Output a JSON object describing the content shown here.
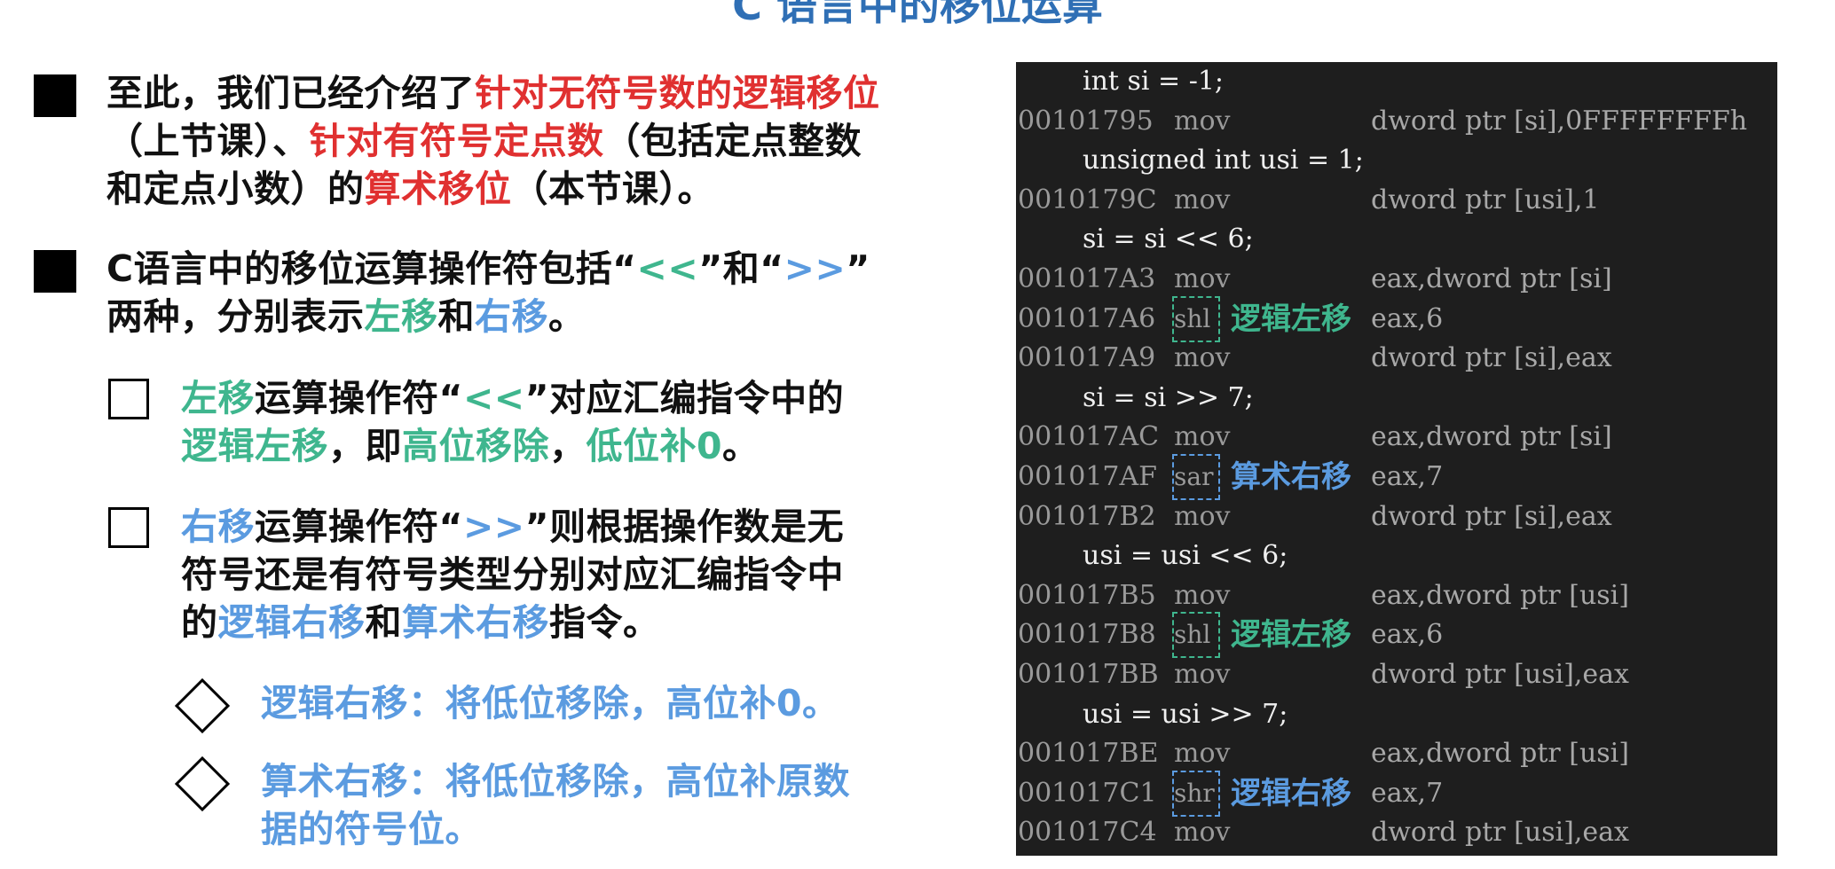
{
  "title": "C 语言中的移位运算",
  "colors": {
    "red": "#e03030",
    "green": "#3fb68e",
    "blue": "#5b9be0",
    "code_bg": "#1e1e1e"
  },
  "left": {
    "p1": {
      "a": "至此，我们已经介绍了",
      "b": "针对无符号数的逻辑移位",
      "c": "（上节课）、",
      "d": "针对有符号定点数",
      "e": "（包括定点整数",
      "f": "和定点小数）的",
      "g": "算术移位",
      "h": "（本节课）。"
    },
    "p2": {
      "a": "C语言中的移位运算操作符包括“",
      "b": "<<",
      "c": "”和“",
      "d": ">>",
      "e": "”",
      "f": "两种，分别表示",
      "g": "左移",
      "h": "和",
      "i": "右移",
      "j": "。"
    },
    "p3": {
      "a": "左移",
      "b": "运算操作符“",
      "c": "<<",
      "d": "”对应汇编指令中的",
      "e": "逻辑左移",
      "f": "，即",
      "g": "高位移除",
      "h": "，",
      "i": "低位补0",
      "j": "。"
    },
    "p4": {
      "a": "右移",
      "b": "运算操作符“",
      "c": ">>",
      "d": "”则根据操作数是无",
      "e": "符号还是有符号类型分别对应汇编指令中",
      "f": "的",
      "g": "逻辑右移",
      "h": "和",
      "i": "算术右移",
      "j": "指令。"
    },
    "p5": "逻辑右移：将低位移除，高位补0。",
    "p6": {
      "a": "算术右移：将低位移除，高位补原数",
      "b": "据的符号位。"
    }
  },
  "code": {
    "rows": [
      {
        "kind": "src",
        "text": "int si = -1;"
      },
      {
        "kind": "asm",
        "addr": "00101795",
        "op": "mov",
        "arg": "dword ptr [si],0FFFFFFFFh"
      },
      {
        "kind": "src",
        "text": "unsigned int usi = 1;"
      },
      {
        "kind": "asm",
        "addr": "0010179C",
        "op": "mov",
        "arg": "dword ptr [usi],1"
      },
      {
        "kind": "src",
        "text": "si = si << 6;"
      },
      {
        "kind": "asm",
        "addr": "001017A3",
        "op": "mov",
        "arg": "eax,dword ptr [si]"
      },
      {
        "kind": "asmhl",
        "addr": "001017A6",
        "op": "shl",
        "tag": "逻辑左移",
        "tone": "g",
        "arg": "eax,6"
      },
      {
        "kind": "asm",
        "addr": "001017A9",
        "op": "mov",
        "arg": "dword ptr [si],eax"
      },
      {
        "kind": "src",
        "text": "si = si >> 7;"
      },
      {
        "kind": "asm",
        "addr": "001017AC",
        "op": "mov",
        "arg": "eax,dword ptr [si]"
      },
      {
        "kind": "asmhl",
        "addr": "001017AF",
        "op": "sar",
        "tag": "算术右移",
        "tone": "b",
        "arg": "eax,7"
      },
      {
        "kind": "asm",
        "addr": "001017B2",
        "op": "mov",
        "arg": "dword ptr [si],eax"
      },
      {
        "kind": "src",
        "text": "usi = usi << 6;"
      },
      {
        "kind": "asm",
        "addr": "001017B5",
        "op": "mov",
        "arg": "eax,dword ptr [usi]"
      },
      {
        "kind": "asmhl",
        "addr": "001017B8",
        "op": "shl",
        "tag": "逻辑左移",
        "tone": "g",
        "arg": "eax,6"
      },
      {
        "kind": "asm",
        "addr": "001017BB",
        "op": "mov",
        "arg": "dword ptr [usi],eax"
      },
      {
        "kind": "src",
        "text": "usi = usi >> 7;"
      },
      {
        "kind": "asm",
        "addr": "001017BE",
        "op": "mov",
        "arg": "eax,dword ptr [usi]"
      },
      {
        "kind": "asmhl",
        "addr": "001017C1",
        "op": "shr",
        "tag": "逻辑右移",
        "tone": "b",
        "arg": "eax,7"
      },
      {
        "kind": "asm",
        "addr": "001017C4",
        "op": "mov",
        "arg": "dword ptr [usi],eax"
      }
    ]
  }
}
